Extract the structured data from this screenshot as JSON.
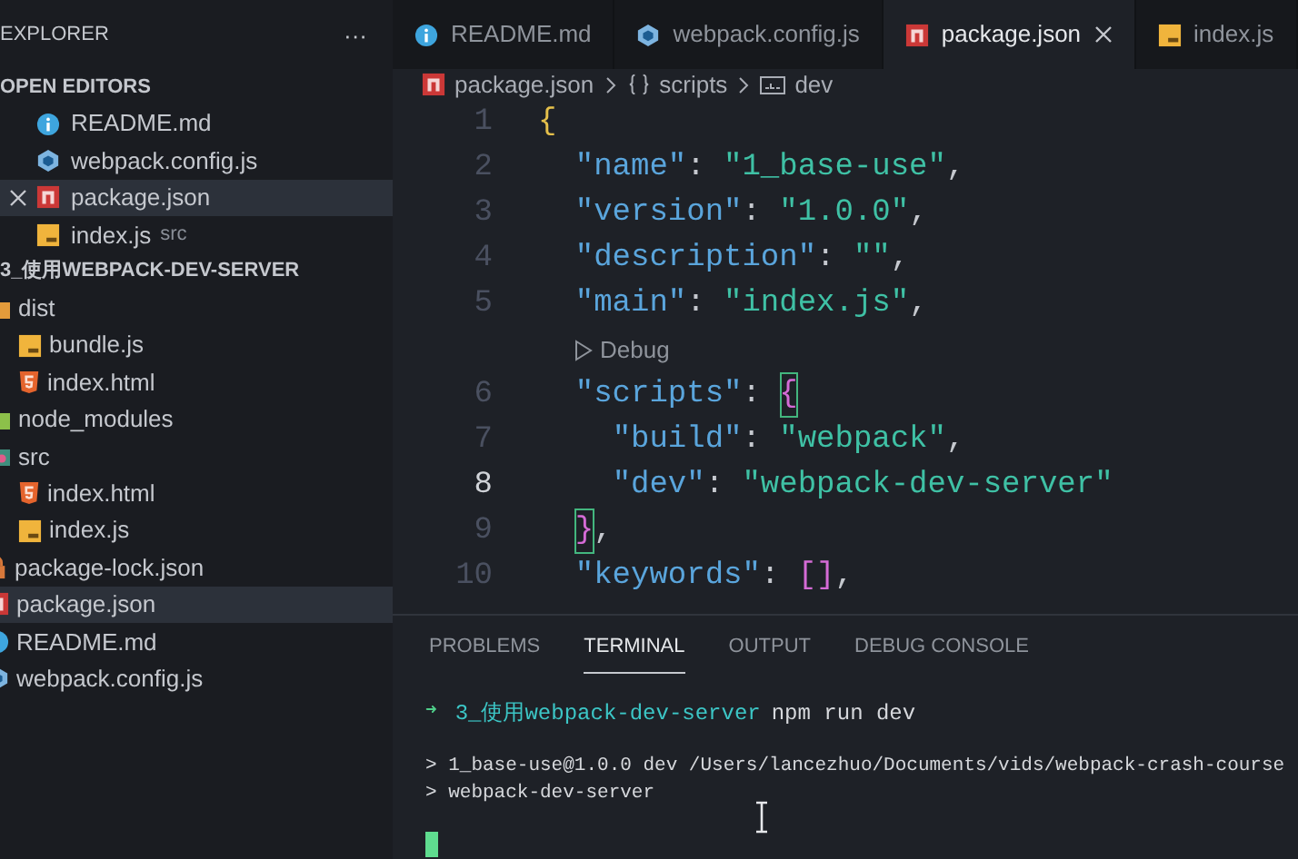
{
  "explorer": {
    "title": "EXPLORER",
    "more": "···"
  },
  "open_editors": {
    "title": "OPEN EDITORS",
    "items": [
      {
        "label": "README.md",
        "kind": "info",
        "selected": false
      },
      {
        "label": "webpack.config.js",
        "kind": "webpack",
        "selected": false
      },
      {
        "label": "package.json",
        "kind": "npm",
        "selected": true
      },
      {
        "label": "index.js",
        "kind": "js",
        "hint": "src",
        "selected": false
      }
    ]
  },
  "project": {
    "title": "3_使用WEBPACK-DEV-SERVER",
    "tree": [
      {
        "label": "dist",
        "kind": "dist",
        "selected": false,
        "children": [
          {
            "label": "bundle.js",
            "kind": "js",
            "selected": false
          },
          {
            "label": "index.html",
            "kind": "html",
            "selected": false
          }
        ]
      },
      {
        "label": "node_modules",
        "kind": "node",
        "selected": false
      },
      {
        "label": "src",
        "kind": "src",
        "selected": false,
        "children": [
          {
            "label": "index.html",
            "kind": "html",
            "selected": false
          },
          {
            "label": "index.js",
            "kind": "js",
            "selected": false
          }
        ]
      },
      {
        "label": "package-lock.json",
        "kind": "lock",
        "selected": false
      },
      {
        "label": "package.json",
        "kind": "npm",
        "selected": true
      },
      {
        "label": "README.md",
        "kind": "info",
        "selected": false
      },
      {
        "label": "webpack.config.js",
        "kind": "webpack",
        "selected": false
      }
    ]
  },
  "tabs": [
    {
      "label": "README.md",
      "kind": "info",
      "selected": false
    },
    {
      "label": "webpack.config.js",
      "kind": "webpack",
      "selected": false
    },
    {
      "label": "package.json",
      "kind": "npm",
      "selected": true
    },
    {
      "label": "index.js",
      "kind": "js",
      "selected": false
    }
  ],
  "breadcrumb": [
    {
      "label": "package.json",
      "kind": "npm"
    },
    {
      "label": "scripts",
      "kind": "object"
    },
    {
      "label": "dev",
      "kind": "string"
    }
  ],
  "editor": {
    "lines": [
      {
        "kind": "code",
        "number": "1",
        "active": false,
        "tokens": [
          {
            "text": "{",
            "kind": "brace1",
            "matched": false
          }
        ]
      },
      {
        "kind": "code",
        "number": "2",
        "active": false,
        "tokens": [
          {
            "text": "  \"name\"",
            "kind": "key"
          },
          {
            "text": ": ",
            "kind": "punct"
          },
          {
            "text": "\"1_base-use\"",
            "kind": "string"
          },
          {
            "text": ",",
            "kind": "punct"
          }
        ]
      },
      {
        "kind": "code",
        "number": "3",
        "active": false,
        "tokens": [
          {
            "text": "  \"version\"",
            "kind": "key"
          },
          {
            "text": ": ",
            "kind": "punct"
          },
          {
            "text": "\"1.0.0\"",
            "kind": "string"
          },
          {
            "text": ",",
            "kind": "punct"
          }
        ]
      },
      {
        "kind": "code",
        "number": "4",
        "active": false,
        "tokens": [
          {
            "text": "  \"description\"",
            "kind": "key"
          },
          {
            "text": ": ",
            "kind": "punct"
          },
          {
            "text": "\"\"",
            "kind": "string"
          },
          {
            "text": ",",
            "kind": "punct"
          }
        ]
      },
      {
        "kind": "code",
        "number": "5",
        "active": false,
        "tokens": [
          {
            "text": "  \"main\"",
            "kind": "key"
          },
          {
            "text": ": ",
            "kind": "punct"
          },
          {
            "text": "\"index.js\"",
            "kind": "string"
          },
          {
            "text": ",",
            "kind": "punct"
          }
        ]
      },
      {
        "kind": "codelens",
        "label": "Debug"
      },
      {
        "kind": "code",
        "number": "6",
        "active": false,
        "tokens": [
          {
            "text": "  \"scripts\"",
            "kind": "key"
          },
          {
            "text": ": ",
            "kind": "punct"
          },
          {
            "text": "{",
            "kind": "brace2",
            "matched": true
          }
        ]
      },
      {
        "kind": "code",
        "number": "7",
        "active": false,
        "tokens": [
          {
            "text": "    \"build\"",
            "kind": "key"
          },
          {
            "text": ": ",
            "kind": "punct"
          },
          {
            "text": "\"webpack\"",
            "kind": "string"
          },
          {
            "text": ",",
            "kind": "punct"
          }
        ]
      },
      {
        "kind": "code",
        "number": "8",
        "active": true,
        "tokens": [
          {
            "text": "    \"dev\"",
            "kind": "key"
          },
          {
            "text": ": ",
            "kind": "punct"
          },
          {
            "text": "\"webpack-dev-server\"",
            "kind": "string"
          }
        ]
      },
      {
        "kind": "code",
        "number": "9",
        "active": false,
        "tokens": [
          {
            "text": "  }",
            "kind": "brace2",
            "matched": true
          },
          {
            "text": ",",
            "kind": "punct"
          }
        ]
      },
      {
        "kind": "code",
        "number": "10",
        "active": false,
        "tokens": [
          {
            "text": "  \"keywords\"",
            "kind": "key"
          },
          {
            "text": ": ",
            "kind": "punct"
          },
          {
            "text": "[]",
            "kind": "brace2",
            "matched": false
          },
          {
            "text": ",",
            "kind": "punct"
          }
        ]
      }
    ]
  },
  "panel": {
    "tabs": [
      {
        "label": "PROBLEMS",
        "selected": false
      },
      {
        "label": "TERMINAL",
        "selected": true
      },
      {
        "label": "OUTPUT",
        "selected": false
      },
      {
        "label": "DEBUG CONSOLE",
        "selected": false
      }
    ],
    "terminal": [
      {
        "kind": "prompt",
        "arrow": "➜",
        "dir": "3_使用webpack-dev-server",
        "command": "npm run dev"
      },
      {
        "kind": "output",
        "text": "> 1_base-use@1.0.0 dev /Users/lancezhuo/Documents/vids/webpack-crash-course"
      },
      {
        "kind": "output",
        "text": "> webpack-dev-server"
      }
    ]
  }
}
